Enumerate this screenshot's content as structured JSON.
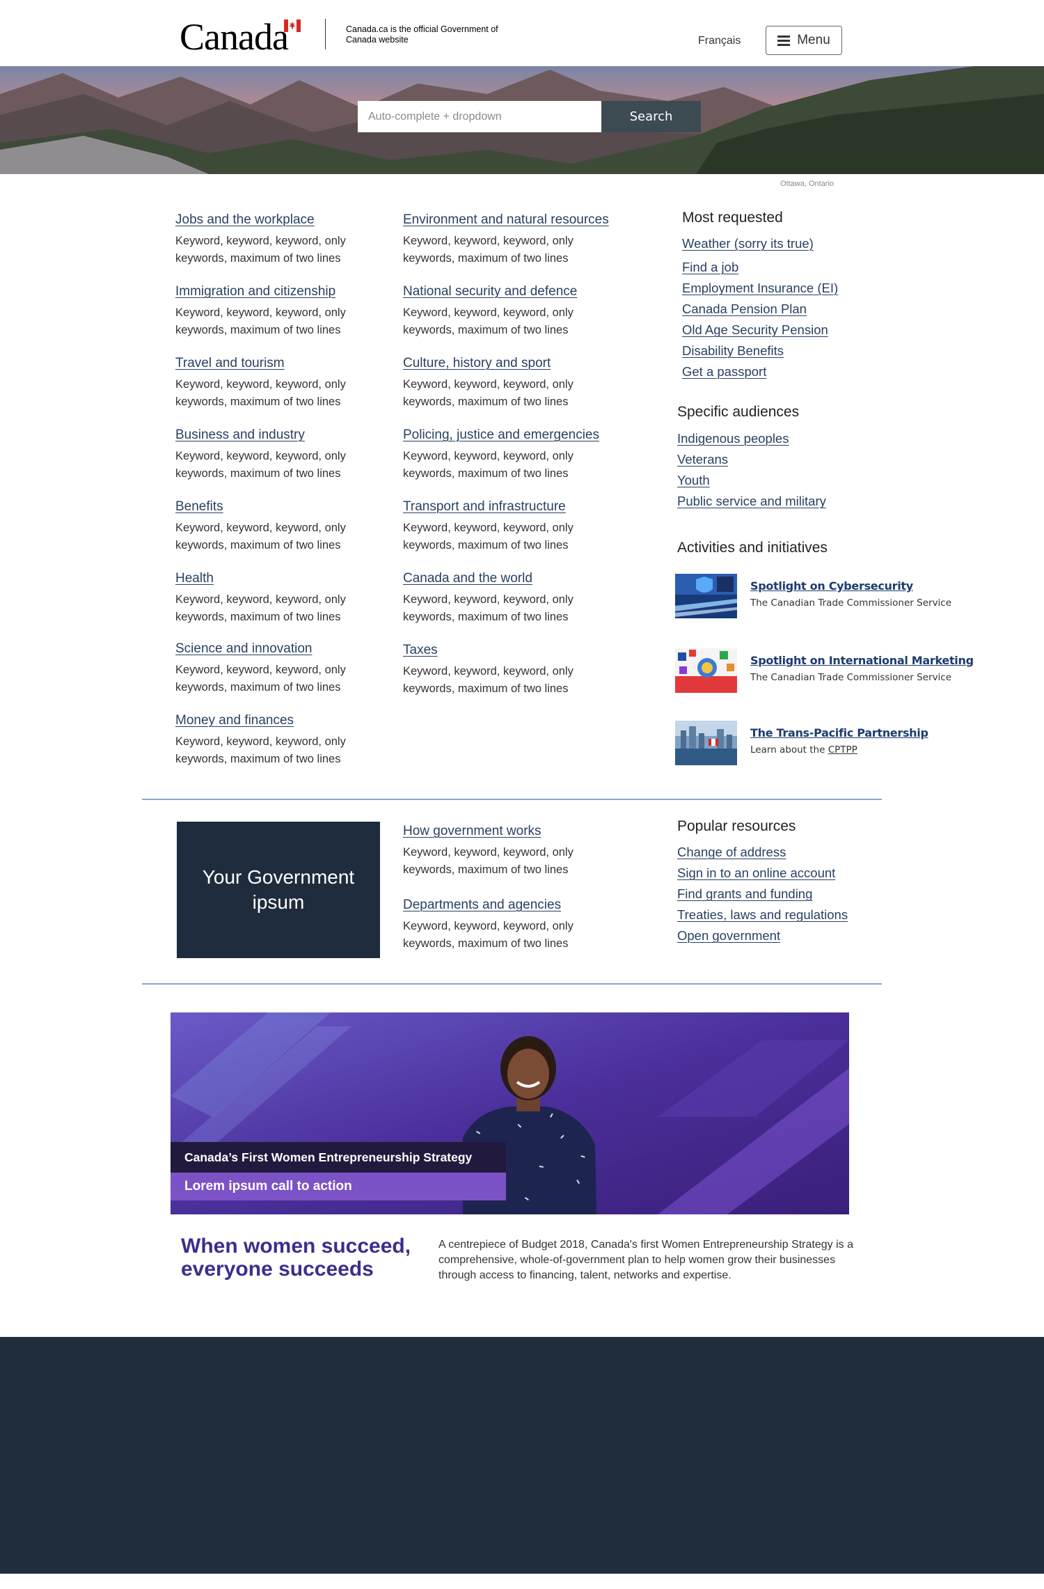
{
  "header": {
    "wordmark": "Canada",
    "tagline": "Canada.ca is the official Government of Canada website",
    "language_link": "Français",
    "menu_label": "Menu"
  },
  "search": {
    "placeholder": "Auto-complete + dropdown",
    "button_label": "Search"
  },
  "hero": {
    "photo_credit": "Ottawa, Ontario"
  },
  "topics_left": [
    {
      "label": "Jobs and the workplace",
      "desc": "Keyword, keyword, keyword, only keywords, maximum of two lines"
    },
    {
      "label": "Immigration and citizenship",
      "desc": "Keyword, keyword, keyword, only keywords, maximum of two lines"
    },
    {
      "label": "Travel and tourism",
      "desc": "Keyword, keyword, keyword, only keywords, maximum of two lines"
    },
    {
      "label": "Business and industry",
      "desc": "Keyword, keyword, keyword, only keywords, maximum of two lines"
    },
    {
      "label": "Benefits",
      "desc": "Keyword, keyword, keyword, only keywords, maximum of two lines"
    },
    {
      "label": "Health",
      "desc": "Keyword, keyword, keyword, only keywords, maximum of two lines"
    },
    {
      "label": "Science and innovation",
      "desc": "Keyword, keyword, keyword, only keywords, maximum of two lines"
    },
    {
      "label": "Money and finances",
      "desc": "Keyword, keyword, keyword, only keywords, maximum of two lines"
    }
  ],
  "topics_right": [
    {
      "label": "Environment and natural resources",
      "desc": "Keyword, keyword, keyword, only keywords, maximum of two lines"
    },
    {
      "label": "National security and defence",
      "desc": "Keyword, keyword, keyword, only keywords, maximum of two lines"
    },
    {
      "label": "Culture, history and sport",
      "desc": "Keyword, keyword, keyword, only keywords, maximum of two lines"
    },
    {
      "label": "Policing, justice and emergencies",
      "desc": "Keyword, keyword, keyword, only keywords, maximum of two lines"
    },
    {
      "label": "Transport and infrastructure",
      "desc": "Keyword, keyword, keyword, only keywords, maximum of two lines"
    },
    {
      "label": "Canada and the world",
      "desc": "Keyword, keyword, keyword, only keywords, maximum of two lines"
    },
    {
      "label": "Taxes",
      "desc": "Keyword, keyword, keyword, only keywords, maximum of two lines"
    }
  ],
  "most_requested": {
    "heading": "Most requested",
    "items": [
      "Weather (sorry its true)",
      "Find a job",
      "Employment Insurance (EI)",
      "Canada Pension Plan",
      "Old Age Security Pension",
      "Disability Benefits",
      "Get a passport"
    ]
  },
  "specific_audiences": {
    "heading": "Specific audiences",
    "items": [
      "Indigenous peoples",
      "Veterans",
      "Youth",
      "Public service and military"
    ]
  },
  "activities": {
    "heading": "Activities and initiatives",
    "items": [
      {
        "title": "Spotlight on Cybersecurity",
        "sub": "The Canadian Trade Commissioner Service"
      },
      {
        "title": "Spotlight on International Marketing",
        "sub": "The Canadian Trade Commissioner Service"
      },
      {
        "title": "The Trans-Pacific Partnership",
        "sub_prefix": "Learn about the ",
        "sub_link": "CPTPP"
      }
    ]
  },
  "government": {
    "box_label": "Your Government ipsum",
    "links": [
      {
        "label": "How government works",
        "desc": "Keyword, keyword, keyword, only keywords, maximum of two lines"
      },
      {
        "label": "Departments and agencies",
        "desc": "Keyword, keyword, keyword, only keywords, maximum of two lines"
      }
    ]
  },
  "popular_resources": {
    "heading": "Popular resources",
    "items": [
      "Change of address",
      "Sign in to an online account",
      "Find grants and funding",
      "Treaties, laws and regulations",
      "Open government"
    ]
  },
  "promo": {
    "title": "Canada’s First Women Entrepreneurship Strategy",
    "cta": "Lorem ipsum call to action",
    "headline": "When women succeed, everyone succeeds",
    "body": "A centrepiece of Budget 2018, Canada's first Women Entrepreneurship Strategy is a comprehensive, whole-of-government plan to help women grow their businesses through access to financing, talent, networks and expertise."
  },
  "colors": {
    "link": "#284162",
    "footer_bg": "#1f2d3d",
    "gov_box_bg": "#1f2c3d",
    "promo_headline": "#3a2f8c",
    "search_button": "#3c4a52"
  }
}
